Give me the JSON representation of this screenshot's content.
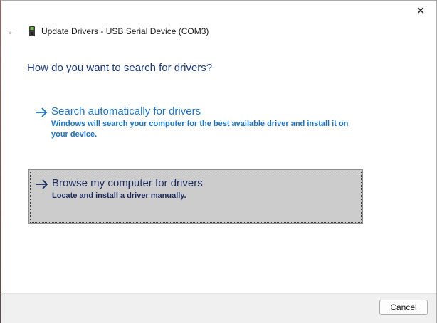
{
  "window": {
    "title": "Update Drivers - USB Serial Device (COM3)",
    "close_symbol": "✕",
    "back_symbol": "←"
  },
  "question": "How do you want to search for drivers?",
  "options": [
    {
      "title": "Search automatically for drivers",
      "description": "Windows will search your computer for the best available driver and install it on your device.",
      "icon": "arrow-right-icon",
      "selected": false
    },
    {
      "title": "Browse my computer for drivers",
      "description": "Locate and install a driver manually.",
      "icon": "arrow-right-icon",
      "selected": true
    }
  ],
  "footer": {
    "cancel_label": "Cancel"
  },
  "colors": {
    "link_blue": "#1a73c9",
    "heading_navy": "#1b3a7a",
    "selected_bg": "#cccccc"
  }
}
